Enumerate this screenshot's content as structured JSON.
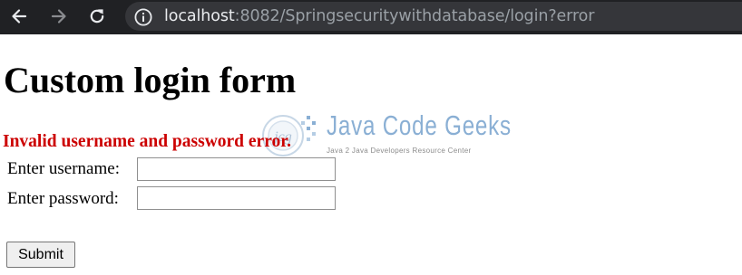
{
  "browser": {
    "url_host": "localhost",
    "url_path": ":8082/Springsecuritywithdatabase/login?error",
    "back_icon": "arrow-left-icon",
    "forward_icon": "arrow-right-icon",
    "reload_icon": "reload-icon",
    "site_info_icon": "info-icon"
  },
  "page": {
    "title": "Custom login form",
    "error_message": "Invalid username and password error.",
    "username_label": "Enter username:",
    "username_value": "",
    "password_label": "Enter password:",
    "password_value": "",
    "submit_label": "Submit"
  },
  "watermark": {
    "name": "Java Code Geeks",
    "tagline": "Java 2 Java Developers Resource Center",
    "badge": "jcg"
  },
  "colors": {
    "error": "#cc0000",
    "browser_bar": "#202124",
    "omnibox": "#35363a",
    "watermark_blue": "#2b6fb2"
  }
}
